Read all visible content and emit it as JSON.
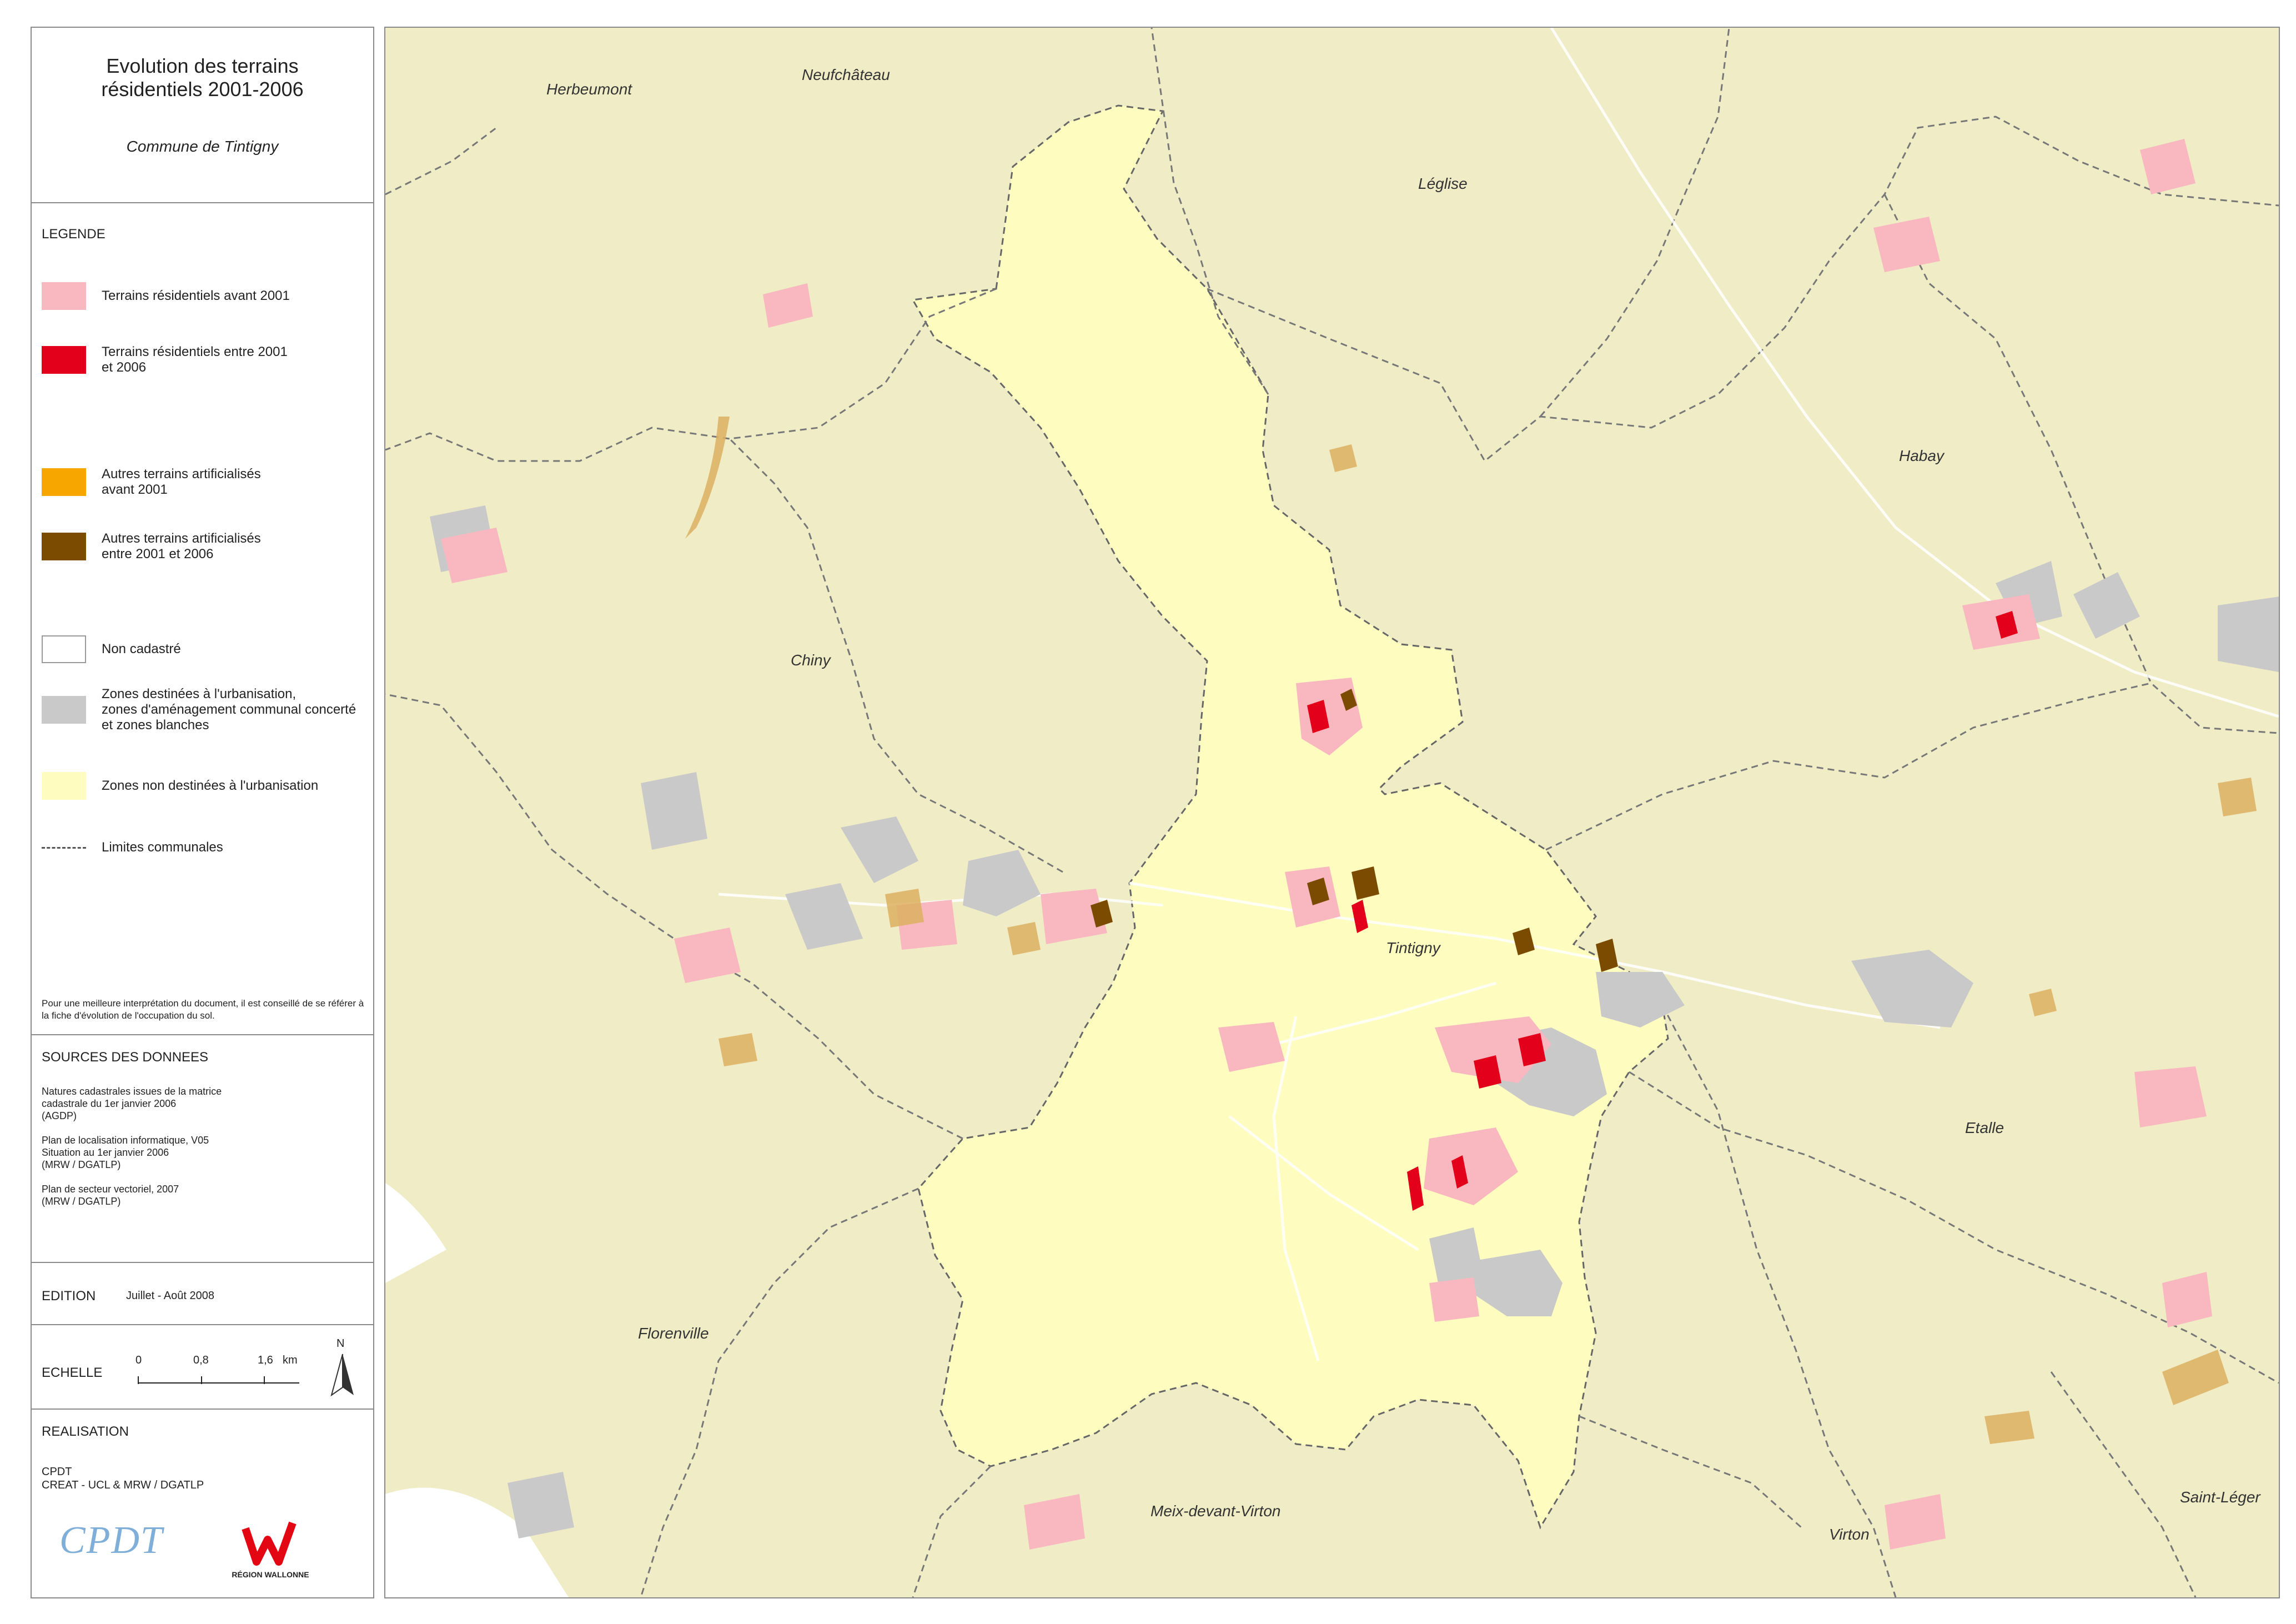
{
  "header": {
    "title_line1": "Evolution des terrains",
    "title_line2": "résidentiels 2001-2006",
    "subtitle": "Commune de Tintigny"
  },
  "legend": {
    "heading": "LEGENDE",
    "items": [
      {
        "label": "Terrains résidentiels avant 2001",
        "color": "#f9b8c0"
      },
      {
        "label": "Terrains résidentiels entre 2001\net 2006",
        "color": "#e3001a"
      },
      {
        "label": "Autres terrains artificialisés\navant 2001",
        "color": "#f7a600"
      },
      {
        "label": "Autres terrains artificialisés\nentre 2001 et 2006",
        "color": "#7a4b00"
      },
      {
        "label": "Non cadastré",
        "color": "#ffffff"
      },
      {
        "label": "Zones destinées à l'urbanisation,\nzones d'aménagement communal concerté\net zones blanches",
        "color": "#c9c9c9"
      },
      {
        "label": "Zones non destinées à l'urbanisation",
        "color": "#fefdbf"
      },
      {
        "label": "Limites communales",
        "color": "#555555"
      }
    ],
    "note": "Pour une meilleure interprétation du document, il est conseillé de se référer à la fiche d'évolution de l'occupation du sol."
  },
  "sources": {
    "heading": "SOURCES DES DONNEES",
    "text": "Natures cadastrales issues de la matrice\ncadastrale du 1er janvier 2006\n(AGDP)\n\nPlan de localisation informatique, V05\nSituation au 1er janvier 2006\n(MRW / DGATLP)\n\nPlan de secteur vectoriel, 2007\n(MRW / DGATLP)"
  },
  "edition": {
    "heading": "EDITION",
    "date": "Juillet - Août 2008"
  },
  "scale": {
    "heading": "ECHELLE",
    "ticks": [
      "0",
      "0,8",
      "1,6"
    ],
    "unit": "km",
    "north": "N"
  },
  "realisation": {
    "heading": "REALISATION",
    "text": "CPDT\nCREAT - UCL & MRW / DGATLP",
    "logo_left": "CPDT",
    "logo_right": "RÉGION WALLONNE"
  },
  "map": {
    "places": {
      "herbeumont": "Herbeumont",
      "neufchateau": "Neufchâteau",
      "leglise": "Léglise",
      "habay": "Habay",
      "chiny": "Chiny",
      "tintigny": "Tintigny",
      "etalle": "Etalle",
      "florenville": "Florenville",
      "meix": "Meix-devant-Virton",
      "virton": "Virton",
      "saint_leger": "Saint-Léger"
    }
  }
}
